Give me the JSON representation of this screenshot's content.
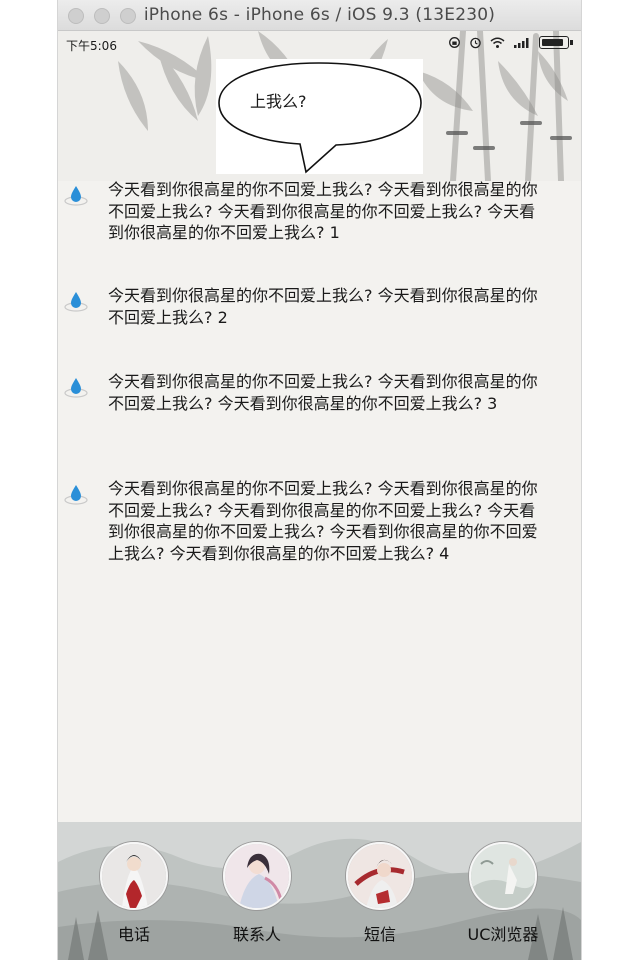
{
  "window": {
    "title": "iPhone 6s - iPhone 6s / iOS 9.3 (13E230)"
  },
  "status_bar": {
    "time": "下午5:06",
    "icons": [
      "rotation-lock-icon",
      "alarm-icon",
      "wifi-icon",
      "signal-icon",
      "battery-icon"
    ]
  },
  "bubble": {
    "text": "上我么?"
  },
  "messages": [
    {
      "text": "今天看到你很高星的你不回爱上我么? 今天看到你很高星的你不回爱上我么? 今天看到你很高星的你不回爱上我么? 今天看到你很高星的你不回爱上我么? 1"
    },
    {
      "text": "今天看到你很高星的你不回爱上我么? 今天看到你很高星的你不回爱上我么? 2"
    },
    {
      "text": "今天看到你很高星的你不回爱上我么? 今天看到你很高星的你不回爱上我么? 今天看到你很高星的你不回爱上我么? 3"
    },
    {
      "text": "今天看到你很高星的你不回爱上我么? 今天看到你很高星的你不回爱上我么? 今天看到你很高星的你不回爱上我么? 今天看到你很高星的你不回爱上我么? 今天看到你很高星的你不回爱上我么? 今天看到你很高星的你不回爱上我么? 4"
    }
  ],
  "dock": {
    "items": [
      {
        "label": "电话"
      },
      {
        "label": "联系人"
      },
      {
        "label": "短信"
      },
      {
        "label": "UC浏览器"
      }
    ]
  },
  "colors": {
    "window_bg": "#f3f2ef",
    "titlebar": "#e3e3e3",
    "drop_icon": "#2a8fd8",
    "text": "#1a1a1a"
  }
}
